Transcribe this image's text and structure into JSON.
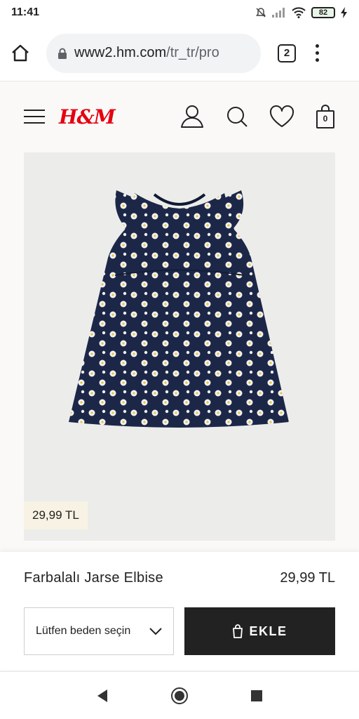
{
  "status_bar": {
    "time": "11:41",
    "battery": "82"
  },
  "browser": {
    "url_domain": "www2.hm.com",
    "url_path": "/tr_tr/pro",
    "tabs_count": "2"
  },
  "site": {
    "logo": "H&M",
    "cart_count": "0"
  },
  "product": {
    "name": "Farbalalı Jarse Elbise",
    "price": "29,99 TL",
    "badge_price": "29,99 TL",
    "size_placeholder": "Lütfen beden seçin",
    "add_label": "EKLE"
  },
  "colors": {
    "brand_red": "#e50010",
    "dress_navy": "#1c2748",
    "button_black": "#222222"
  },
  "icons": [
    "home-icon",
    "lock-icon",
    "kebab-menu-icon",
    "hamburger-icon",
    "user-icon",
    "search-icon",
    "heart-icon",
    "cart-icon",
    "chevron-down-icon",
    "bag-icon",
    "back-icon",
    "home-circle-icon",
    "recents-icon"
  ]
}
